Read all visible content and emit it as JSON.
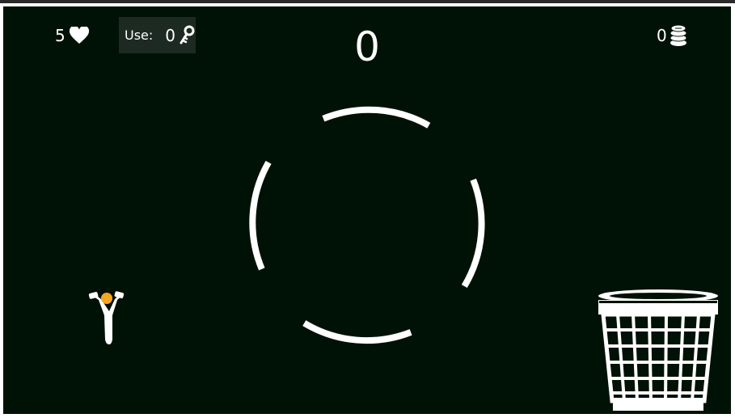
{
  "hud": {
    "lives": "5",
    "lives_icon": "heart-icon",
    "use_label": "Use:",
    "keys": "0",
    "key_icon": "key-icon",
    "score": "0",
    "coins": "0",
    "coins_icon": "coin-stack-icon"
  },
  "objects": {
    "slingshot_icon": "slingshot-icon",
    "ball_color": "#f5a623",
    "target_ring_icon": "segmented-ring-target",
    "basket_icon": "wastebasket-icon"
  },
  "colors": {
    "background": "#001206",
    "foreground": "#ffffff",
    "hud_box": "#1d2a22"
  }
}
